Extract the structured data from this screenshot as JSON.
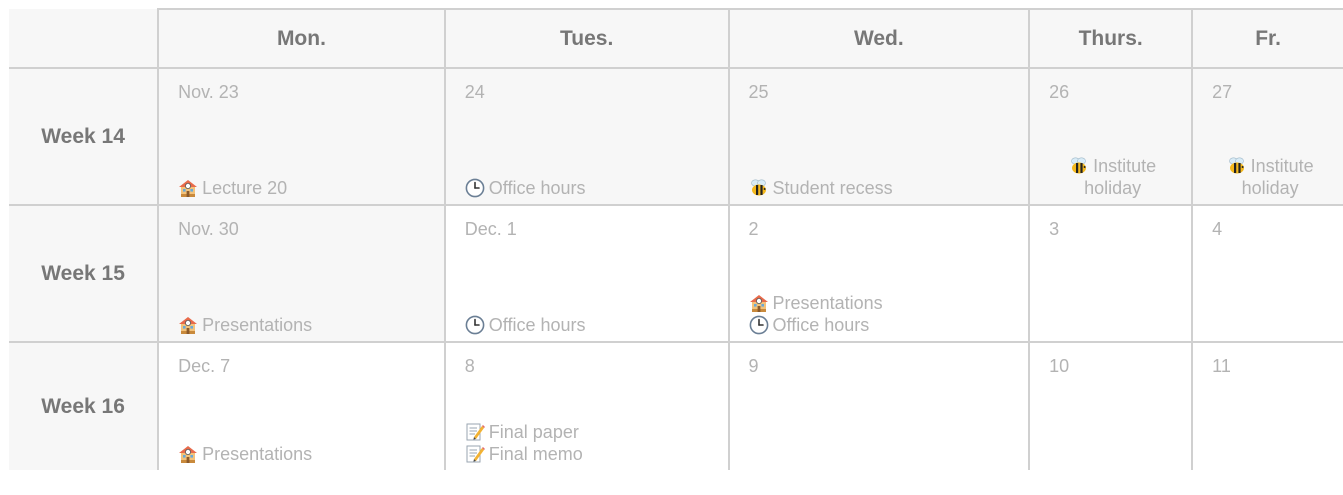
{
  "header": {
    "corner": "",
    "days": [
      "Mon.",
      "Tues.",
      "Wed.",
      "Thurs.",
      "Fr."
    ]
  },
  "weeks": [
    {
      "label": "Week 14",
      "cells": [
        {
          "date": "Nov. 23",
          "events": [
            {
              "icon": "school-icon",
              "text": "Lecture 20"
            }
          ]
        },
        {
          "date": "24",
          "events": [
            {
              "icon": "clock-icon",
              "text": "Office hours"
            }
          ]
        },
        {
          "date": "25",
          "events": [
            {
              "icon": "bee-icon",
              "text": "Student recess"
            }
          ]
        },
        {
          "date": "26",
          "events": [
            {
              "icon": "bee-icon",
              "text": "Institute holiday"
            }
          ]
        },
        {
          "date": "27",
          "events": [
            {
              "icon": "bee-icon",
              "text": "Institute holiday"
            }
          ]
        }
      ]
    },
    {
      "label": "Week 15",
      "cells": [
        {
          "date": "Nov. 30",
          "events": [
            {
              "icon": "school-icon",
              "text": "Presentations"
            }
          ]
        },
        {
          "date": "Dec. 1",
          "events": [
            {
              "icon": "clock-icon",
              "text": "Office hours"
            }
          ]
        },
        {
          "date": "2",
          "events": [
            {
              "icon": "school-icon",
              "text": "Presentations"
            },
            {
              "icon": "clock-icon",
              "text": "Office hours"
            }
          ]
        },
        {
          "date": "3",
          "events": []
        },
        {
          "date": "4",
          "events": []
        }
      ]
    },
    {
      "label": "Week 16",
      "cells": [
        {
          "date": "Dec. 7",
          "events": [
            {
              "icon": "school-icon",
              "text": "Presentations"
            }
          ]
        },
        {
          "date": "8",
          "events": [
            {
              "icon": "memo-icon",
              "text": "Final paper"
            },
            {
              "icon": "memo-icon",
              "text": "Final memo"
            }
          ]
        },
        {
          "date": "9",
          "events": []
        },
        {
          "date": "10",
          "events": []
        },
        {
          "date": "11",
          "events": []
        }
      ]
    }
  ],
  "colors": {
    "border": "#d0d0d0",
    "header_background": "#f7f7f7",
    "header_text": "#777777",
    "faded_text": "#b3b3b3"
  }
}
